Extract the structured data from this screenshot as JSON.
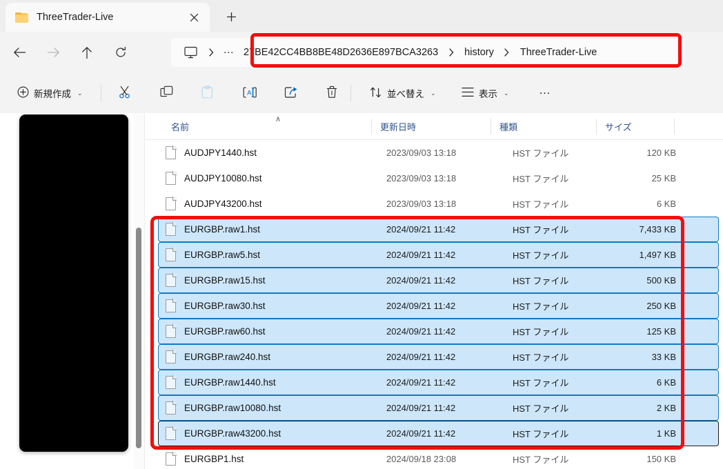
{
  "window": {
    "tab": {
      "title": "ThreeTrader-Live",
      "folder_icon": "folder-icon",
      "close_icon": "close-icon"
    },
    "new_tab_icon": "plus-icon"
  },
  "nav": {
    "back_icon": "arrow-left-icon",
    "forward_icon": "arrow-right-icon",
    "up_icon": "arrow-up-icon",
    "refresh_icon": "refresh-icon"
  },
  "address": {
    "pc_icon": "monitor-icon",
    "separator": "›",
    "ellipsis": "…",
    "crumbs": [
      "27BE42CC4BB8BE48D2636E897BCA3263",
      "history",
      "ThreeTrader-Live"
    ]
  },
  "toolbar": {
    "new_label": "新規作成",
    "new_icon": "plus-circle-icon",
    "cut_icon": "scissors-icon",
    "copy_icon": "copy-icon",
    "paste_icon": "paste-icon",
    "rename_icon": "rename-icon",
    "share_icon": "share-icon",
    "delete_icon": "trash-icon",
    "sort_label": "並べ替え",
    "sort_icon": "sort-arrows-icon",
    "view_label": "表示",
    "view_icon": "list-lines-icon",
    "more_label": "…",
    "chevron": "⌄"
  },
  "columns": {
    "name": "名前",
    "date": "更新日時",
    "type": "種類",
    "size": "サイズ",
    "sort_caret": "∧"
  },
  "files": [
    {
      "name": "AUDJPY1440.hst",
      "date": "2023/09/03 13:18",
      "type": "HST ファイル",
      "size": "120 KB",
      "selected": false,
      "focused": false
    },
    {
      "name": "AUDJPY10080.hst",
      "date": "2023/09/03 13:18",
      "type": "HST ファイル",
      "size": "25 KB",
      "selected": false,
      "focused": false
    },
    {
      "name": "AUDJPY43200.hst",
      "date": "2023/09/03 13:18",
      "type": "HST ファイル",
      "size": "6 KB",
      "selected": false,
      "focused": false
    },
    {
      "name": "EURGBP.raw1.hst",
      "date": "2024/09/21 11:42",
      "type": "HST ファイル",
      "size": "7,433 KB",
      "selected": true,
      "focused": false
    },
    {
      "name": "EURGBP.raw5.hst",
      "date": "2024/09/21 11:42",
      "type": "HST ファイル",
      "size": "1,497 KB",
      "selected": true,
      "focused": false
    },
    {
      "name": "EURGBP.raw15.hst",
      "date": "2024/09/21 11:42",
      "type": "HST ファイル",
      "size": "500 KB",
      "selected": true,
      "focused": false
    },
    {
      "name": "EURGBP.raw30.hst",
      "date": "2024/09/21 11:42",
      "type": "HST ファイル",
      "size": "250 KB",
      "selected": true,
      "focused": false
    },
    {
      "name": "EURGBP.raw60.hst",
      "date": "2024/09/21 11:42",
      "type": "HST ファイル",
      "size": "125 KB",
      "selected": true,
      "focused": false
    },
    {
      "name": "EURGBP.raw240.hst",
      "date": "2024/09/21 11:42",
      "type": "HST ファイル",
      "size": "33 KB",
      "selected": true,
      "focused": false
    },
    {
      "name": "EURGBP.raw1440.hst",
      "date": "2024/09/21 11:42",
      "type": "HST ファイル",
      "size": "6 KB",
      "selected": true,
      "focused": false
    },
    {
      "name": "EURGBP.raw10080.hst",
      "date": "2024/09/21 11:42",
      "type": "HST ファイル",
      "size": "2 KB",
      "selected": true,
      "focused": false
    },
    {
      "name": "EURGBP.raw43200.hst",
      "date": "2024/09/21 11:42",
      "type": "HST ファイル",
      "size": "1 KB",
      "selected": true,
      "focused": true
    },
    {
      "name": "EURGBP1.hst",
      "date": "2024/09/18 23:08",
      "type": "HST ファイル",
      "size": "150 KB",
      "selected": false,
      "focused": false
    }
  ],
  "annotations": {
    "color": "#f40d0d",
    "address_box": "address-bar-highlight",
    "selection_box": "selected-files-highlight"
  },
  "colors": {
    "selection_fill": "#cde6fa",
    "selection_border": "#0d7ac4",
    "header_text": "#30548f",
    "accent": "#0067c0"
  }
}
